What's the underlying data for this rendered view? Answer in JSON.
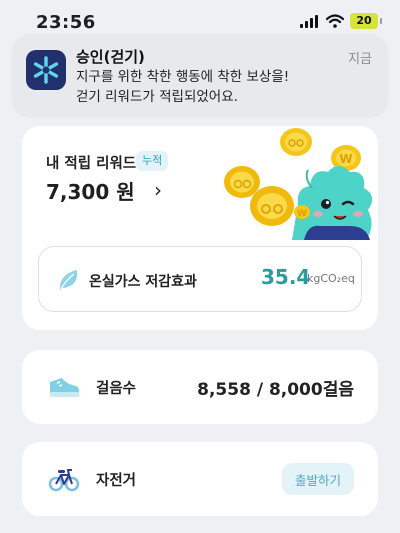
{
  "status_bar": {
    "time": "23:56",
    "battery": "20"
  },
  "notification": {
    "title": "승인(걷기)",
    "time": "지금",
    "line1": "지구를 위한 착한 행동에 착한 보상을!",
    "line2": "걷기 리워드가 적립되었어요."
  },
  "reward": {
    "label": "내 적립 리워드",
    "badge": "누적",
    "amount": "7,300 원",
    "chevron": "›"
  },
  "ghg": {
    "label": "온실가스 저감효과",
    "value": "35.4",
    "unit": "kgCO₂eq"
  },
  "steps": {
    "label": "걸음수",
    "value": "8,558 / 8,000걸음"
  },
  "bike": {
    "label": "자전거",
    "button": "출발하기"
  },
  "colors": {
    "accent": "#2a9b9e",
    "notif_icon_bg": "#23306e",
    "coin": "#f5c518",
    "mascot": "#4ed3c8"
  },
  "icons": [
    "signal-icon",
    "wifi-icon",
    "battery-icon",
    "app-logo-icon",
    "leaf-icon",
    "sneaker-icon",
    "bicycle-icon",
    "chevron-right-icon"
  ]
}
